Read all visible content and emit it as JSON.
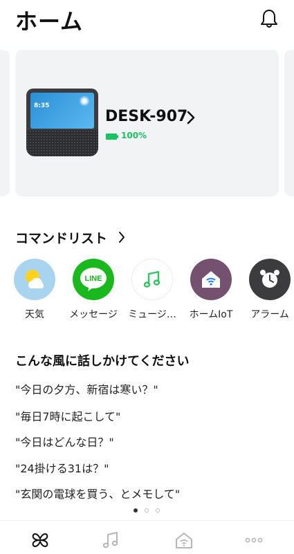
{
  "header": {
    "title": "ホーム"
  },
  "device": {
    "name": "DESK-907",
    "battery": "100%",
    "battery_level": 1.0,
    "screen_time": "8:35"
  },
  "commands": {
    "title": "コマンドリスト",
    "items": [
      {
        "label": "天気",
        "icon": "weather-icon",
        "color": "#a9d4ef"
      },
      {
        "label": "メッセージ",
        "icon": "line-icon",
        "color": "#19b91e"
      },
      {
        "label": "ミュージ…",
        "icon": "music-icon",
        "color": "#ffffff"
      },
      {
        "label": "ホームIoT",
        "icon": "home-iot-icon",
        "color": "#74516f"
      },
      {
        "label": "アラーム",
        "icon": "alarm-clock-icon",
        "color": "#3c3c3e"
      }
    ]
  },
  "suggestions": {
    "title": "こんな風に話しかけてください",
    "phrases": [
      "\"今日の夕方、新宿は寒い？\"",
      "\"毎日7時に起こして\"",
      "\"今日はどんな日？\"",
      "\"24掛ける31は？\"",
      "\"玄関の電球を買う、とメモして\""
    ]
  },
  "pager": {
    "total": 3,
    "active": 1
  },
  "tabbar": {
    "tabs": [
      {
        "icon": "clover-home-icon",
        "active": true
      },
      {
        "icon": "music-note-icon",
        "active": false
      },
      {
        "icon": "home-wifi-icon",
        "active": false
      },
      {
        "icon": "more-dots-icon",
        "active": false
      }
    ]
  },
  "colors": {
    "accent": "#19c364",
    "card": "#f2f3f5"
  }
}
